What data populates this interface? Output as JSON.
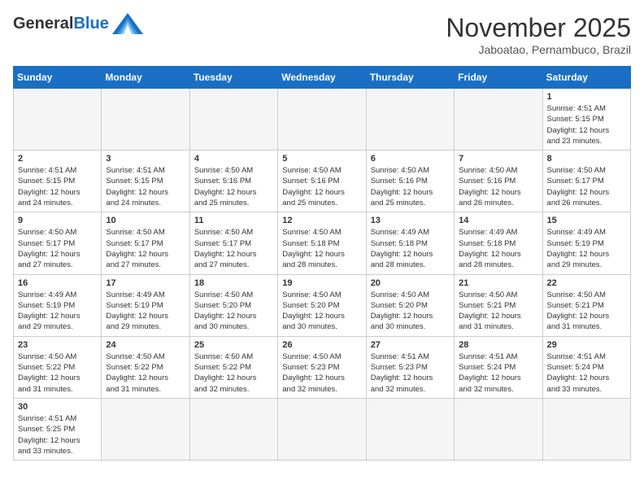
{
  "header": {
    "logo_general": "General",
    "logo_blue": "Blue",
    "title": "November 2025",
    "subtitle": "Jaboatao, Pernambuco, Brazil"
  },
  "weekdays": [
    "Sunday",
    "Monday",
    "Tuesday",
    "Wednesday",
    "Thursday",
    "Friday",
    "Saturday"
  ],
  "weeks": [
    [
      {
        "day": "",
        "info": ""
      },
      {
        "day": "",
        "info": ""
      },
      {
        "day": "",
        "info": ""
      },
      {
        "day": "",
        "info": ""
      },
      {
        "day": "",
        "info": ""
      },
      {
        "day": "",
        "info": ""
      },
      {
        "day": "1",
        "info": "Sunrise: 4:51 AM\nSunset: 5:15 PM\nDaylight: 12 hours\nand 23 minutes."
      }
    ],
    [
      {
        "day": "2",
        "info": "Sunrise: 4:51 AM\nSunset: 5:15 PM\nDaylight: 12 hours\nand 24 minutes."
      },
      {
        "day": "3",
        "info": "Sunrise: 4:51 AM\nSunset: 5:15 PM\nDaylight: 12 hours\nand 24 minutes."
      },
      {
        "day": "4",
        "info": "Sunrise: 4:50 AM\nSunset: 5:16 PM\nDaylight: 12 hours\nand 25 minutes."
      },
      {
        "day": "5",
        "info": "Sunrise: 4:50 AM\nSunset: 5:16 PM\nDaylight: 12 hours\nand 25 minutes."
      },
      {
        "day": "6",
        "info": "Sunrise: 4:50 AM\nSunset: 5:16 PM\nDaylight: 12 hours\nand 25 minutes."
      },
      {
        "day": "7",
        "info": "Sunrise: 4:50 AM\nSunset: 5:16 PM\nDaylight: 12 hours\nand 26 minutes."
      },
      {
        "day": "8",
        "info": "Sunrise: 4:50 AM\nSunset: 5:17 PM\nDaylight: 12 hours\nand 26 minutes."
      }
    ],
    [
      {
        "day": "9",
        "info": "Sunrise: 4:50 AM\nSunset: 5:17 PM\nDaylight: 12 hours\nand 27 minutes."
      },
      {
        "day": "10",
        "info": "Sunrise: 4:50 AM\nSunset: 5:17 PM\nDaylight: 12 hours\nand 27 minutes."
      },
      {
        "day": "11",
        "info": "Sunrise: 4:50 AM\nSunset: 5:17 PM\nDaylight: 12 hours\nand 27 minutes."
      },
      {
        "day": "12",
        "info": "Sunrise: 4:50 AM\nSunset: 5:18 PM\nDaylight: 12 hours\nand 28 minutes."
      },
      {
        "day": "13",
        "info": "Sunrise: 4:49 AM\nSunset: 5:18 PM\nDaylight: 12 hours\nand 28 minutes."
      },
      {
        "day": "14",
        "info": "Sunrise: 4:49 AM\nSunset: 5:18 PM\nDaylight: 12 hours\nand 28 minutes."
      },
      {
        "day": "15",
        "info": "Sunrise: 4:49 AM\nSunset: 5:19 PM\nDaylight: 12 hours\nand 29 minutes."
      }
    ],
    [
      {
        "day": "16",
        "info": "Sunrise: 4:49 AM\nSunset: 5:19 PM\nDaylight: 12 hours\nand 29 minutes."
      },
      {
        "day": "17",
        "info": "Sunrise: 4:49 AM\nSunset: 5:19 PM\nDaylight: 12 hours\nand 29 minutes."
      },
      {
        "day": "18",
        "info": "Sunrise: 4:50 AM\nSunset: 5:20 PM\nDaylight: 12 hours\nand 30 minutes."
      },
      {
        "day": "19",
        "info": "Sunrise: 4:50 AM\nSunset: 5:20 PM\nDaylight: 12 hours\nand 30 minutes."
      },
      {
        "day": "20",
        "info": "Sunrise: 4:50 AM\nSunset: 5:20 PM\nDaylight: 12 hours\nand 30 minutes."
      },
      {
        "day": "21",
        "info": "Sunrise: 4:50 AM\nSunset: 5:21 PM\nDaylight: 12 hours\nand 31 minutes."
      },
      {
        "day": "22",
        "info": "Sunrise: 4:50 AM\nSunset: 5:21 PM\nDaylight: 12 hours\nand 31 minutes."
      }
    ],
    [
      {
        "day": "23",
        "info": "Sunrise: 4:50 AM\nSunset: 5:22 PM\nDaylight: 12 hours\nand 31 minutes."
      },
      {
        "day": "24",
        "info": "Sunrise: 4:50 AM\nSunset: 5:22 PM\nDaylight: 12 hours\nand 31 minutes."
      },
      {
        "day": "25",
        "info": "Sunrise: 4:50 AM\nSunset: 5:22 PM\nDaylight: 12 hours\nand 32 minutes."
      },
      {
        "day": "26",
        "info": "Sunrise: 4:50 AM\nSunset: 5:23 PM\nDaylight: 12 hours\nand 32 minutes."
      },
      {
        "day": "27",
        "info": "Sunrise: 4:51 AM\nSunset: 5:23 PM\nDaylight: 12 hours\nand 32 minutes."
      },
      {
        "day": "28",
        "info": "Sunrise: 4:51 AM\nSunset: 5:24 PM\nDaylight: 12 hours\nand 32 minutes."
      },
      {
        "day": "29",
        "info": "Sunrise: 4:51 AM\nSunset: 5:24 PM\nDaylight: 12 hours\nand 33 minutes."
      }
    ],
    [
      {
        "day": "30",
        "info": "Sunrise: 4:51 AM\nSunset: 5:25 PM\nDaylight: 12 hours\nand 33 minutes."
      },
      {
        "day": "",
        "info": ""
      },
      {
        "day": "",
        "info": ""
      },
      {
        "day": "",
        "info": ""
      },
      {
        "day": "",
        "info": ""
      },
      {
        "day": "",
        "info": ""
      },
      {
        "day": "",
        "info": ""
      }
    ]
  ],
  "colors": {
    "header_bg": "#1a6fc4",
    "accent_blue": "#1a6fc4"
  }
}
